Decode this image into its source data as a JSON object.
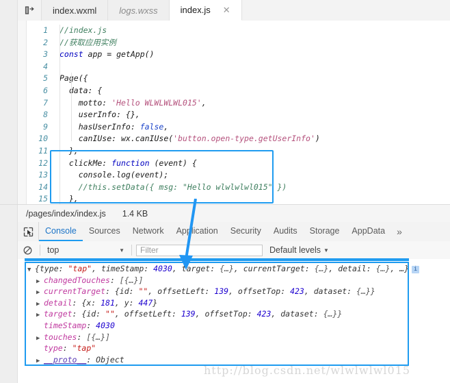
{
  "tabbar": {
    "panel_icon": "split-panel-icon",
    "tabs": [
      {
        "label": "index.wxml",
        "state": "inactive"
      },
      {
        "label": "logs.wxss",
        "state": "preview"
      },
      {
        "label": "index.js",
        "state": "active"
      }
    ],
    "close_glyph": "✕"
  },
  "editor": {
    "line_numbers": [
      "1",
      "2",
      "3",
      "4",
      "5",
      "6",
      "7",
      "8",
      "9",
      "10",
      "11",
      "12",
      "13",
      "14",
      "15"
    ],
    "lines": [
      {
        "n": "1",
        "text": "//index.js"
      },
      {
        "n": "2",
        "text": "//获取应用实例"
      },
      {
        "n": "3",
        "text": "const app = getApp()"
      },
      {
        "n": "4",
        "text": ""
      },
      {
        "n": "5",
        "text": "Page({"
      },
      {
        "n": "6",
        "text": "  data: {"
      },
      {
        "n": "7",
        "text": "    motto: 'Hello WLWLWLWL015',"
      },
      {
        "n": "8",
        "text": "    userInfo: {},"
      },
      {
        "n": "9",
        "text": "    hasUserInfo: false,"
      },
      {
        "n": "10",
        "text": "    canIUse: wx.canIUse('button.open-type.getUserInfo')"
      },
      {
        "n": "11",
        "text": "  },"
      },
      {
        "n": "12",
        "text": "  clickMe: function (event) {"
      },
      {
        "n": "13",
        "text": "    console.log(event);"
      },
      {
        "n": "14",
        "text": "    //this.setData({ msg: \"Hello wlwlwlwl015\" })"
      },
      {
        "n": "15",
        "text": "  },"
      }
    ],
    "highlight_color": "#1e9bf0"
  },
  "pathbar": {
    "path": "/pages/index/index.js",
    "size": "1.4 KB"
  },
  "devtools": {
    "inspect_icon": "inspect-element-icon",
    "tabs": [
      {
        "label": "Console",
        "active": true
      },
      {
        "label": "Sources",
        "active": false
      },
      {
        "label": "Network",
        "active": false
      },
      {
        "label": "Application",
        "active": false
      },
      {
        "label": "Security",
        "active": false
      },
      {
        "label": "Audits",
        "active": false
      },
      {
        "label": "Storage",
        "active": false
      },
      {
        "label": "AppData",
        "active": false
      }
    ],
    "more_glyph": "»"
  },
  "filterbar": {
    "clear_icon": "clear-console-icon",
    "context_value": "top",
    "context_caret": "▼",
    "filter_placeholder": "Filter",
    "filter_value": "",
    "levels_label": "Default levels",
    "levels_caret": "▼"
  },
  "console": {
    "accent_color": "#1e9bf0",
    "info_badge": "i",
    "entries": [
      {
        "id": "root",
        "expander": "▼",
        "indent": 0,
        "segments": [
          {
            "t": "{",
            "c": "plain"
          },
          {
            "t": "type: ",
            "c": "plain"
          },
          {
            "t": "\"tap\"",
            "c": "str"
          },
          {
            "t": ", timeStamp: ",
            "c": "plain"
          },
          {
            "t": "4030",
            "c": "num"
          },
          {
            "t": ", target: ",
            "c": "plain"
          },
          {
            "t": "{…}",
            "c": "gray"
          },
          {
            "t": ", currentTarget: ",
            "c": "plain"
          },
          {
            "t": "{…}",
            "c": "gray"
          },
          {
            "t": ", detail: ",
            "c": "plain"
          },
          {
            "t": "{…}",
            "c": "gray"
          },
          {
            "t": ", …}",
            "c": "plain"
          }
        ],
        "badge": true
      },
      {
        "id": "changedTouches",
        "expander": "▶",
        "indent": 1,
        "segments": [
          {
            "t": "changedTouches",
            "c": "prop"
          },
          {
            "t": ": ",
            "c": "plain"
          },
          {
            "t": "[{…}]",
            "c": "gray"
          }
        ],
        "badge": false
      },
      {
        "id": "currentTarget",
        "expander": "▶",
        "indent": 1,
        "segments": [
          {
            "t": "currentTarget",
            "c": "prop"
          },
          {
            "t": ": {id: ",
            "c": "plain"
          },
          {
            "t": "\"\"",
            "c": "str"
          },
          {
            "t": ", offsetLeft: ",
            "c": "plain"
          },
          {
            "t": "139",
            "c": "num"
          },
          {
            "t": ", offsetTop: ",
            "c": "plain"
          },
          {
            "t": "423",
            "c": "num"
          },
          {
            "t": ", dataset: ",
            "c": "plain"
          },
          {
            "t": "{…}}",
            "c": "gray"
          }
        ],
        "badge": false
      },
      {
        "id": "detail",
        "expander": "▶",
        "indent": 1,
        "segments": [
          {
            "t": "detail",
            "c": "prop"
          },
          {
            "t": ": {x: ",
            "c": "plain"
          },
          {
            "t": "181",
            "c": "num"
          },
          {
            "t": ", y: ",
            "c": "plain"
          },
          {
            "t": "447",
            "c": "num"
          },
          {
            "t": "}",
            "c": "plain"
          }
        ],
        "badge": false
      },
      {
        "id": "target",
        "expander": "▶",
        "indent": 1,
        "segments": [
          {
            "t": "target",
            "c": "prop"
          },
          {
            "t": ": {id: ",
            "c": "plain"
          },
          {
            "t": "\"\"",
            "c": "str"
          },
          {
            "t": ", offsetLeft: ",
            "c": "plain"
          },
          {
            "t": "139",
            "c": "num"
          },
          {
            "t": ", offsetTop: ",
            "c": "plain"
          },
          {
            "t": "423",
            "c": "num"
          },
          {
            "t": ", dataset: ",
            "c": "plain"
          },
          {
            "t": "{…}}",
            "c": "gray"
          }
        ],
        "badge": false
      },
      {
        "id": "timeStamp",
        "expander": "",
        "indent": 1,
        "segments": [
          {
            "t": "timeStamp",
            "c": "prop"
          },
          {
            "t": ": ",
            "c": "plain"
          },
          {
            "t": "4030",
            "c": "num"
          }
        ],
        "badge": false
      },
      {
        "id": "touches",
        "expander": "▶",
        "indent": 1,
        "segments": [
          {
            "t": "touches",
            "c": "prop"
          },
          {
            "t": ": ",
            "c": "plain"
          },
          {
            "t": "[{…}]",
            "c": "gray"
          }
        ],
        "badge": false
      },
      {
        "id": "type",
        "expander": "",
        "indent": 1,
        "segments": [
          {
            "t": "type",
            "c": "prop"
          },
          {
            "t": ": ",
            "c": "plain"
          },
          {
            "t": "\"tap\"",
            "c": "str"
          }
        ],
        "badge": false
      },
      {
        "id": "proto",
        "expander": "▶",
        "indent": 1,
        "segments": [
          {
            "t": "__proto__",
            "c": "proto"
          },
          {
            "t": ": Object",
            "c": "plain"
          }
        ],
        "badge": false
      }
    ]
  },
  "watermark": {
    "text": "http://blog.csdn.net/wlwlwlwl015"
  }
}
